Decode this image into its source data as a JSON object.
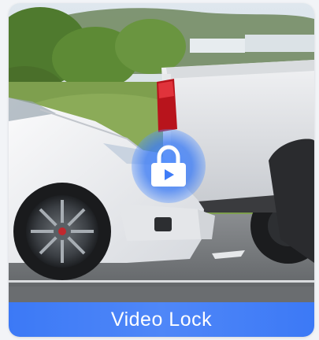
{
  "card": {
    "title": "Video Lock",
    "icon": "lock-play-icon",
    "accent_color": "#3f7cf7"
  }
}
